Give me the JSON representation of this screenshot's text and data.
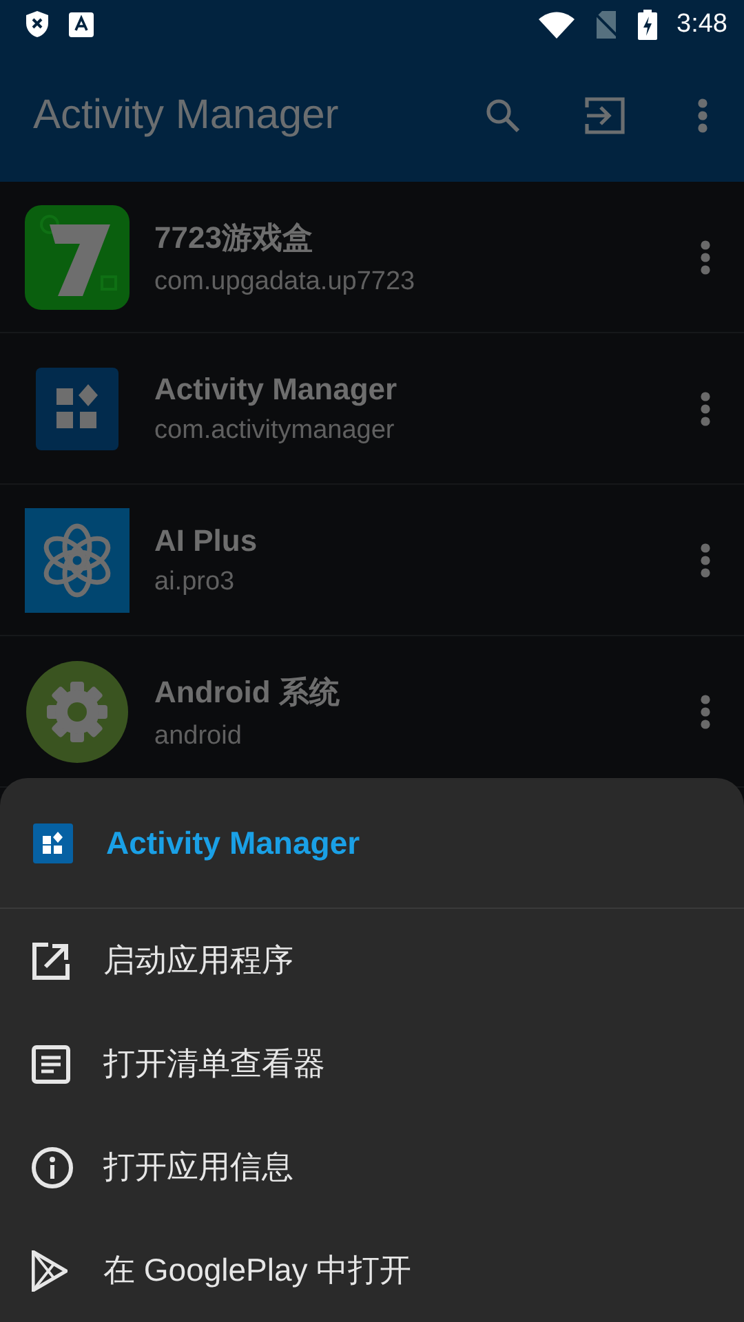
{
  "status_bar": {
    "time": "3:48"
  },
  "app_bar": {
    "title": "Activity Manager"
  },
  "apps": [
    {
      "name": "7723游戏盒",
      "package": "com.upgadata.up7723",
      "kind": "seven"
    },
    {
      "name": "Activity Manager",
      "package": "com.activitymanager",
      "kind": "grid"
    },
    {
      "name": "AI Plus",
      "package": "ai.pro3",
      "kind": "knot"
    },
    {
      "name": "Android 系统",
      "package": "android",
      "kind": "gear"
    }
  ],
  "sheet": {
    "title": "Activity Manager",
    "items": [
      {
        "label": "启动应用程序",
        "kind": "launch"
      },
      {
        "label": "打开清单查看器",
        "kind": "manifest"
      },
      {
        "label": "打开应用信息",
        "kind": "info"
      },
      {
        "label": "在 GooglePlay 中打开",
        "kind": "play"
      }
    ]
  }
}
